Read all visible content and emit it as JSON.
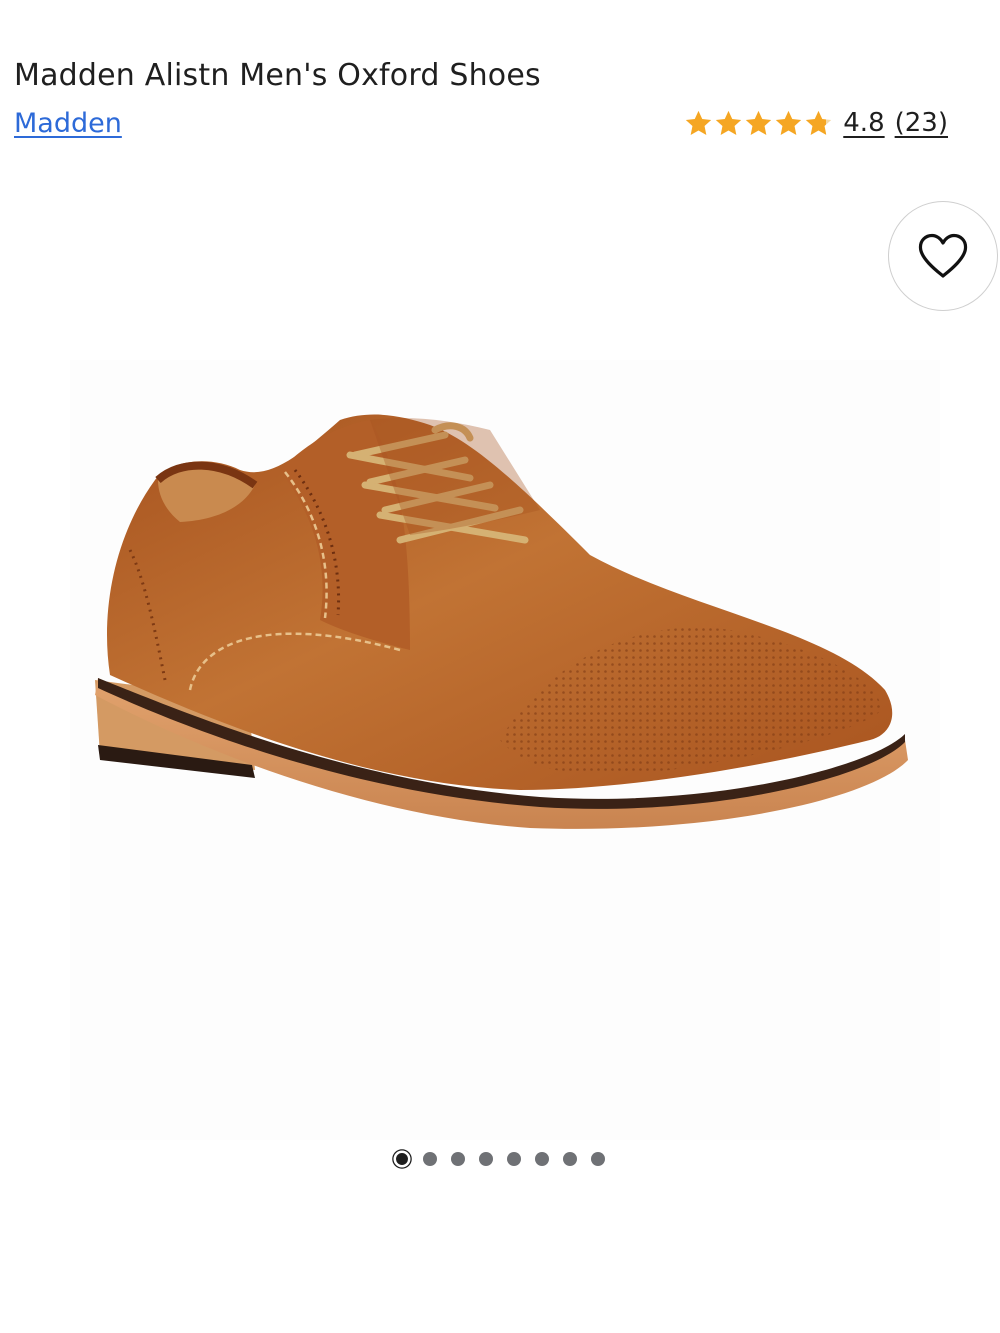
{
  "product": {
    "title": "Madden Alistn Men's Oxford Shoes",
    "brand": "Madden"
  },
  "rating": {
    "stars": 4.8,
    "star_icon": "star-icon",
    "value": "4.8",
    "count": "(23)"
  },
  "favorite": {
    "icon": "heart-icon"
  },
  "gallery": {
    "image": "brown-oxford-shoe",
    "total_images": 8,
    "current_index": 0
  },
  "colors": {
    "brand_link": "#2d6ad8",
    "star": "#f5a623",
    "leather": "#b8662e",
    "dot": "#6f7175",
    "dot_active": "#1e1e1e"
  }
}
